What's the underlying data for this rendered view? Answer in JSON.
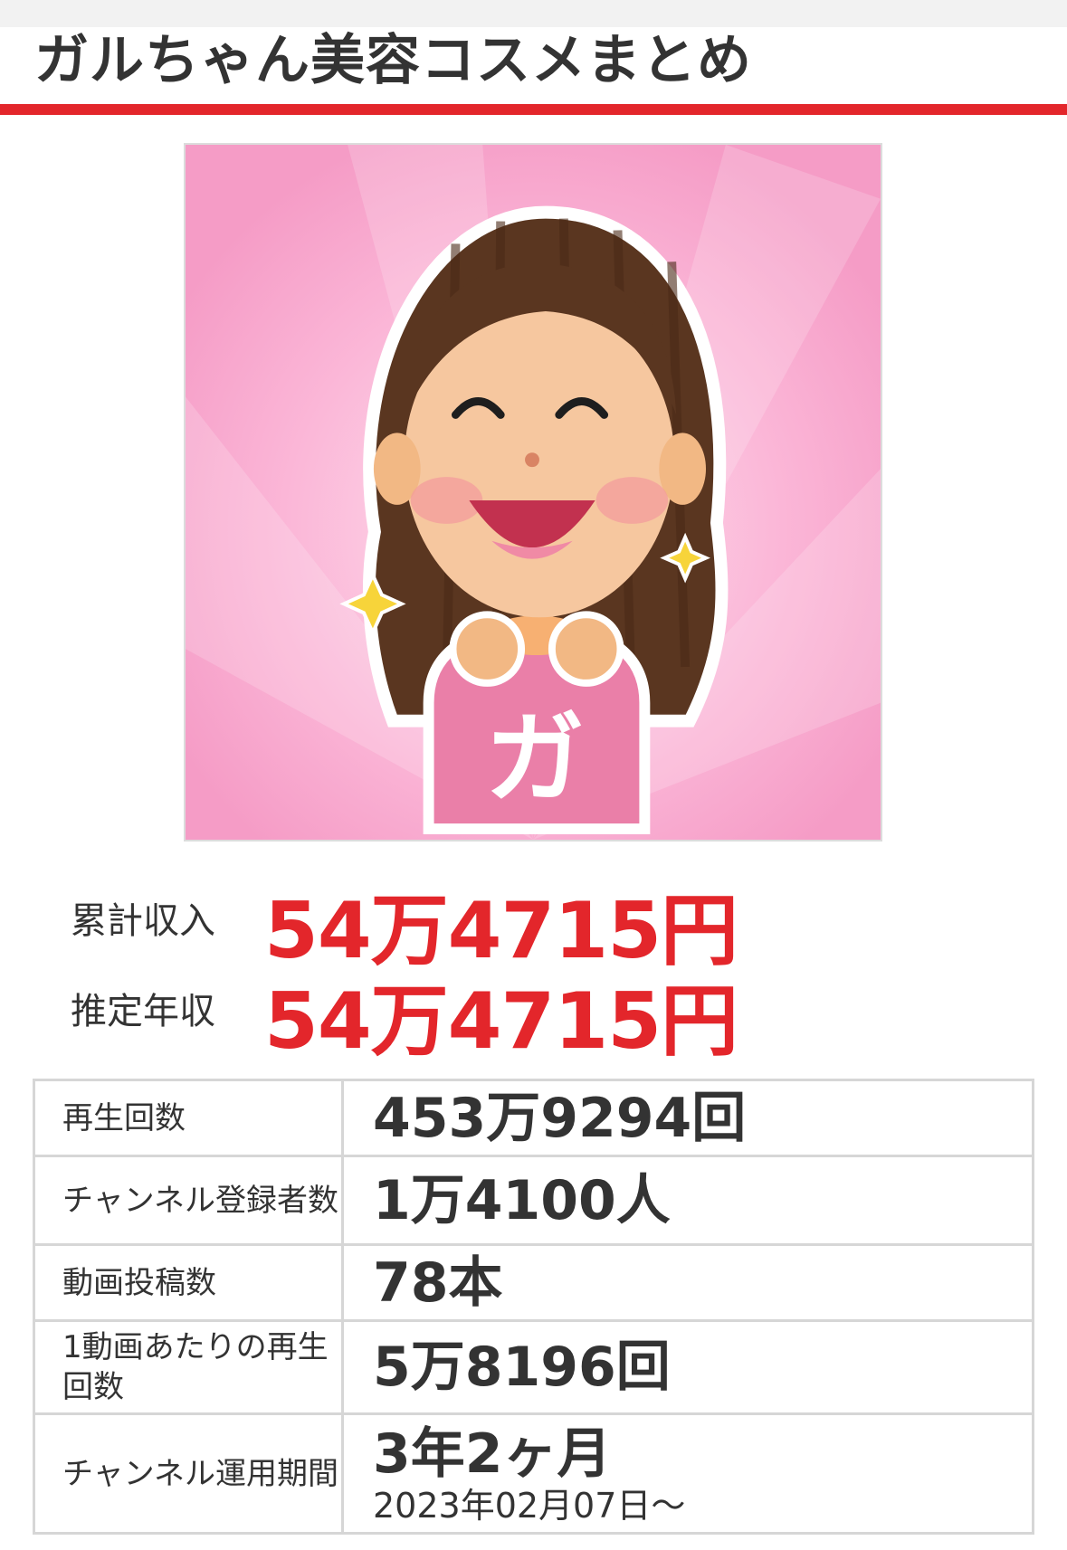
{
  "header": {
    "title": "ガルちゃん美容コスメまとめ"
  },
  "thumbnail": {
    "icon": "channel-avatar-image",
    "badge_char": "ガ"
  },
  "income": {
    "cumulative": {
      "label": "累計収入",
      "value": "54万4715円"
    },
    "annual": {
      "label": "推定年収",
      "value": "54万4715円"
    }
  },
  "stats": [
    {
      "label": "再生回数",
      "value": "453万9294回"
    },
    {
      "label": "チャンネル登録者数",
      "value": "1万4100人"
    },
    {
      "label": "動画投稿数",
      "value": "78本"
    },
    {
      "label": "1動画あたりの再生回数",
      "value": "5万8196回"
    },
    {
      "label": "チャンネル運用期間",
      "value": "3年2ヶ月",
      "sub": "2023年02月07日〜"
    }
  ],
  "colors": {
    "accent": "#e3262b",
    "text": "#333333",
    "thumb_bg": "#fbb3d6"
  }
}
